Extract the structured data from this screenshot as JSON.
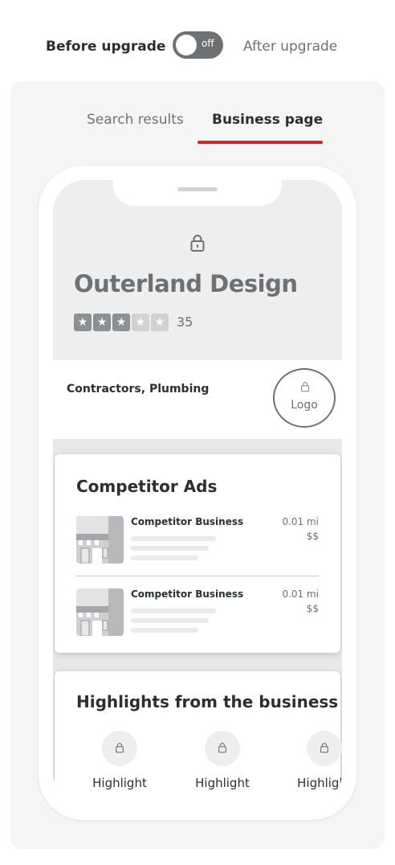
{
  "toggle": {
    "before_label": "Before upgrade",
    "state_text": "off",
    "after_label": "After upgrade"
  },
  "tabs": [
    {
      "label": "Search results",
      "active": false
    },
    {
      "label": "Business page",
      "active": true
    }
  ],
  "business": {
    "name": "Outerland Design",
    "rating_stars": 3,
    "rating_max": 5,
    "review_count": "35",
    "categories": "Contractors, Plumbing",
    "logo_label": "Logo"
  },
  "competitor_ads": {
    "title": "Competitor Ads",
    "items": [
      {
        "name": "Competitor Business",
        "distance": "0.01 mi",
        "price": "$$"
      },
      {
        "name": "Competitor Business",
        "distance": "0.01 mi",
        "price": "$$"
      }
    ]
  },
  "highlights": {
    "title": "Highlights from the business",
    "items": [
      {
        "label": "Highlight"
      },
      {
        "label": "Highlight"
      },
      {
        "label": "Highlight"
      }
    ]
  },
  "icons": {
    "lock": "lock-icon",
    "star": "star-icon",
    "storefront": "storefront-icon"
  },
  "colors": {
    "accent_red": "#d32323",
    "toggle_off": "#6e7072",
    "panel_bg": "#f5f5f5",
    "text_dark": "#2d2e2f",
    "text_muted": "#6e7072"
  }
}
